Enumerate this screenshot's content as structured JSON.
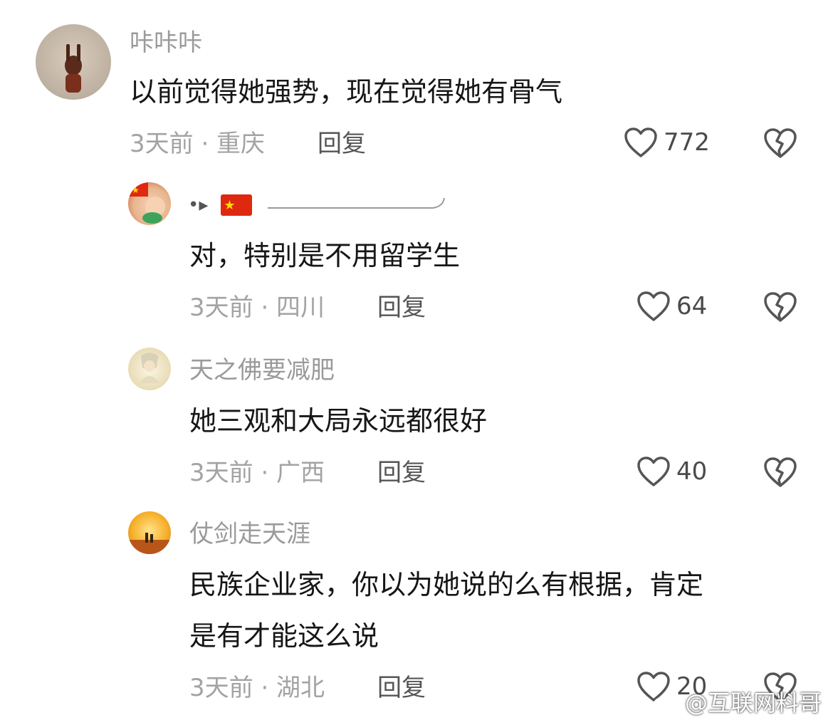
{
  "comments": [
    {
      "author": "咔咔咔",
      "text": "以前觉得她强势，现在觉得她有骨气",
      "meta": "3天前 · 重庆",
      "reply_label": "回复",
      "likes": "772"
    },
    {
      "author": "",
      "author_decor": "🇨🇳",
      "text": "对，特别是不用留学生",
      "meta": "3天前 · 四川",
      "reply_label": "回复",
      "likes": "64"
    },
    {
      "author": "天之佛要减肥",
      "text": "她三观和大局永远都很好",
      "meta": "3天前 · 广西",
      "reply_label": "回复",
      "likes": "40"
    },
    {
      "author": "仗剑走天涯",
      "text_line1": "民族企业家，你以为她说的么有根据，肯定",
      "text_line2": "是有才能这么说",
      "meta": "3天前 · 湖北",
      "reply_label": "回复",
      "likes": "20"
    }
  ],
  "watermark": "@互联网料哥",
  "icons": {
    "like": "heart-outline-icon",
    "dislike": "broken-heart-icon",
    "weibo": "weibo-logo-icon"
  }
}
